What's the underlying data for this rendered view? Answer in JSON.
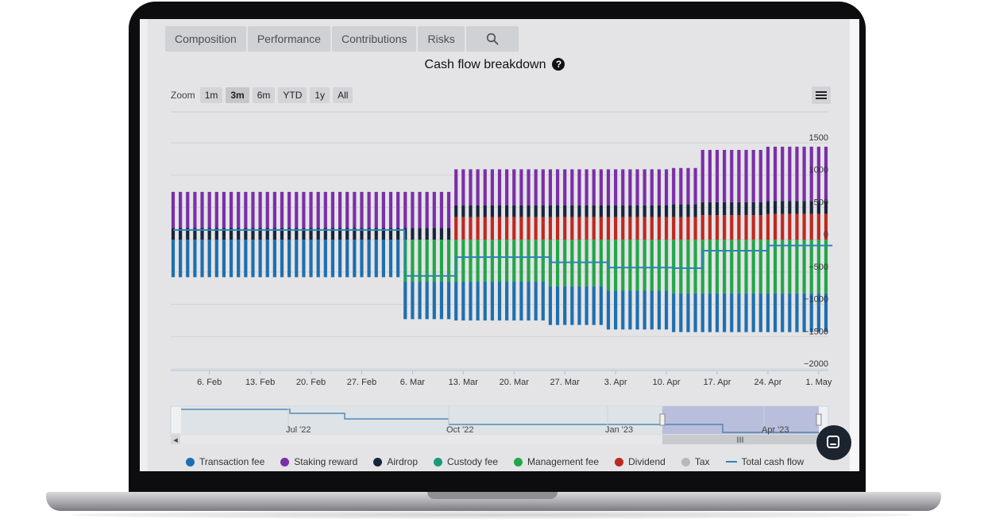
{
  "tabs": {
    "composition": "Composition",
    "performance": "Performance",
    "contributions": "Contributions",
    "risks": "Risks"
  },
  "title": "Cash flow breakdown",
  "help_glyph": "?",
  "zoom": {
    "label": "Zoom",
    "buttons": [
      "1m",
      "3m",
      "6m",
      "YTD",
      "1y",
      "All"
    ],
    "selected": "3m"
  },
  "navigator": {
    "labels": [
      "Jul '22",
      "Oct '22",
      "Jan '23",
      "Apr '23"
    ],
    "scroll_left": "◂",
    "scroll_grip": "III"
  },
  "colors": {
    "transaction_fee": "#1f6fae",
    "staking_reward": "#7b2fa8",
    "airdrop": "#17243a",
    "custody_fee": "#1a9a7a",
    "management_fee": "#22a64a",
    "dividend": "#c0281f",
    "tax": "#b8b8ba",
    "total_cash_flow": "#2a86b5"
  },
  "chart_data": {
    "type": "bar",
    "stacked": true,
    "title": "Cash flow breakdown",
    "xlabel": "",
    "ylabel": "",
    "ylim": [
      -2000,
      1500
    ],
    "y_ticks": [
      1500,
      1000,
      500,
      0,
      -500,
      -1000,
      -1500,
      -2000
    ],
    "x_tick_labels": [
      "6. Feb",
      "13. Feb",
      "20. Feb",
      "27. Feb",
      "6. Mar",
      "13. Mar",
      "20. Mar",
      "27. Mar",
      "3. Apr",
      "10. Apr",
      "17. Apr",
      "24. Apr",
      "1. May"
    ],
    "segments": [
      {
        "from": "2023-02-01",
        "to": "2023-03-04",
        "transaction_fee": -580,
        "staking_reward": 560,
        "airdrop": 180,
        "dividend": 0,
        "management_fee": 0,
        "custody_fee": 0,
        "total": 150
      },
      {
        "from": "2023-03-05",
        "to": "2023-03-11",
        "transaction_fee": -580,
        "staking_reward": 560,
        "airdrop": 180,
        "dividend": 0,
        "management_fee": -650,
        "custody_fee": 0,
        "total": -560
      },
      {
        "from": "2023-03-12",
        "to": "2023-03-24",
        "transaction_fee": -600,
        "staking_reward": 560,
        "airdrop": 180,
        "dividend": 350,
        "management_fee": -650,
        "custody_fee": 0,
        "total": -270
      },
      {
        "from": "2023-03-25",
        "to": "2023-04-01",
        "transaction_fee": -600,
        "staking_reward": 560,
        "airdrop": 180,
        "dividend": 350,
        "management_fee": -720,
        "custody_fee": 0,
        "total": -350
      },
      {
        "from": "2023-04-02",
        "to": "2023-04-10",
        "transaction_fee": -600,
        "staking_reward": 560,
        "airdrop": 180,
        "dividend": 350,
        "management_fee": -790,
        "custody_fee": 0,
        "total": -430
      },
      {
        "from": "2023-04-11",
        "to": "2023-04-14",
        "transaction_fee": -600,
        "staking_reward": 560,
        "airdrop": 200,
        "dividend": 350,
        "management_fee": -830,
        "custody_fee": 0,
        "total": -440
      },
      {
        "from": "2023-04-15",
        "to": "2023-04-23",
        "transaction_fee": -600,
        "staking_reward": 810,
        "airdrop": 200,
        "dividend": 380,
        "management_fee": -830,
        "custody_fee": 0,
        "total": -170
      },
      {
        "from": "2023-04-24",
        "to": "2023-05-02",
        "transaction_fee": -600,
        "staking_reward": 840,
        "airdrop": 200,
        "dividend": 400,
        "management_fee": -830,
        "custody_fee": 0,
        "total": -90
      }
    ],
    "series": [
      {
        "name": "Transaction fee",
        "key": "transaction_fee"
      },
      {
        "name": "Staking reward",
        "key": "staking_reward"
      },
      {
        "name": "Airdrop",
        "key": "airdrop"
      },
      {
        "name": "Custody fee",
        "key": "custody_fee"
      },
      {
        "name": "Management fee",
        "key": "management_fee"
      },
      {
        "name": "Dividend",
        "key": "dividend"
      },
      {
        "name": "Tax",
        "key": "tax"
      },
      {
        "name": "Total cash flow",
        "key": "total"
      }
    ],
    "legend_position": "bottom",
    "grid": true
  }
}
